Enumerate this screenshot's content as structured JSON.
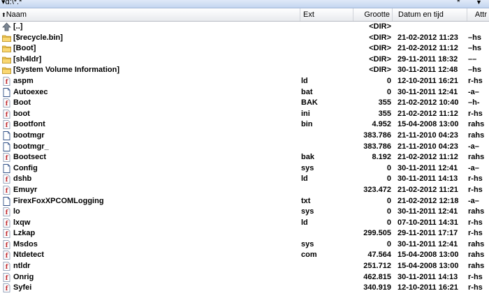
{
  "pathbar": {
    "path": "▾d:\\*.*",
    "filter_icon": "*",
    "dropdown_icon": "▼"
  },
  "columns": {
    "name": "Naam",
    "sort_arrow": "⬆",
    "ext": "Ext",
    "size": "Grootte",
    "date": "Datum en tijd",
    "attr": "Attr"
  },
  "rows": [
    {
      "icon": "up-icon",
      "name": "[..]",
      "ext": "",
      "size": "<DIR>",
      "date": "",
      "attr": ""
    },
    {
      "icon": "folder-icon",
      "name": "[$recycle.bin]",
      "ext": "",
      "size": "<DIR>",
      "date": "21-02-2012 11:23",
      "attr": "–hs"
    },
    {
      "icon": "folder-icon",
      "name": "[Boot]",
      "ext": "",
      "size": "<DIR>",
      "date": "21-02-2012 11:12",
      "attr": "–hs"
    },
    {
      "icon": "folder-icon",
      "name": "[sh4ldr]",
      "ext": "",
      "size": "<DIR>",
      "date": "29-11-2011 18:32",
      "attr": "––"
    },
    {
      "icon": "folder-icon",
      "name": "[System Volume Information]",
      "ext": "",
      "size": "<DIR>",
      "date": "30-11-2011 12:48",
      "attr": "–hs"
    },
    {
      "icon": "file-icon",
      "name": "aspm",
      "ext": "ld",
      "size": "0",
      "date": "12-10-2011 16:21",
      "attr": "r-hs"
    },
    {
      "icon": "blank-file-icon",
      "name": "Autoexec",
      "ext": "bat",
      "size": "0",
      "date": "30-11-2011 12:41",
      "attr": "-a–"
    },
    {
      "icon": "file-icon",
      "name": "Boot",
      "ext": "BAK",
      "size": "355",
      "date": "21-02-2012 10:40",
      "attr": "–h-"
    },
    {
      "icon": "file-icon",
      "name": "boot",
      "ext": "ini",
      "size": "355",
      "date": "21-02-2012 11:12",
      "attr": "r-hs"
    },
    {
      "icon": "file-icon",
      "name": "Bootfont",
      "ext": "bin",
      "size": "4.952",
      "date": "15-04-2008 13:00",
      "attr": "rahs"
    },
    {
      "icon": "blank-file-icon",
      "name": "bootmgr",
      "ext": "",
      "size": "383.786",
      "date": "21-11-2010 04:23",
      "attr": "rahs"
    },
    {
      "icon": "blank-file-icon",
      "name": "bootmgr_",
      "ext": "",
      "size": "383.786",
      "date": "21-11-2010 04:23",
      "attr": "-a–"
    },
    {
      "icon": "file-icon",
      "name": "Bootsect",
      "ext": "bak",
      "size": "8.192",
      "date": "21-02-2012 11:12",
      "attr": "rahs"
    },
    {
      "icon": "blank-file-icon",
      "name": "Config",
      "ext": "sys",
      "size": "0",
      "date": "30-11-2011 12:41",
      "attr": "-a–"
    },
    {
      "icon": "file-icon",
      "name": "dshb",
      "ext": "ld",
      "size": "0",
      "date": "30-11-2011 14:13",
      "attr": "r-hs"
    },
    {
      "icon": "file-icon",
      "name": "Emuyr",
      "ext": "",
      "size": "323.472",
      "date": "21-02-2012 11:21",
      "attr": "r-hs"
    },
    {
      "icon": "blank-file-icon",
      "name": "FirexFoxXPCOMLogging",
      "ext": "txt",
      "size": "0",
      "date": "21-02-2012 12:18",
      "attr": "-a–"
    },
    {
      "icon": "file-icon",
      "name": "lo",
      "ext": "sys",
      "size": "0",
      "date": "30-11-2011 12:41",
      "attr": "rahs"
    },
    {
      "icon": "file-icon",
      "name": "lxqw",
      "ext": "ld",
      "size": "0",
      "date": "07-10-2011 14:31",
      "attr": "r-hs"
    },
    {
      "icon": "file-icon",
      "name": "Lzkap",
      "ext": "",
      "size": "299.505",
      "date": "29-11-2011 17:17",
      "attr": "r-hs"
    },
    {
      "icon": "file-icon",
      "name": "Msdos",
      "ext": "sys",
      "size": "0",
      "date": "30-11-2011 12:41",
      "attr": "rahs"
    },
    {
      "icon": "file-icon",
      "name": "Ntdetect",
      "ext": "com",
      "size": "47.564",
      "date": "15-04-2008 13:00",
      "attr": "rahs"
    },
    {
      "icon": "file-icon",
      "name": "ntldr",
      "ext": "",
      "size": "251.712",
      "date": "15-04-2008 13:00",
      "attr": "rahs"
    },
    {
      "icon": "file-icon",
      "name": "Onrig",
      "ext": "",
      "size": "462.815",
      "date": "30-11-2011 14:13",
      "attr": "r-hs"
    },
    {
      "icon": "file-icon",
      "name": "Syfei",
      "ext": "",
      "size": "340.919",
      "date": "12-10-2011 16:21",
      "attr": "r-hs"
    }
  ]
}
